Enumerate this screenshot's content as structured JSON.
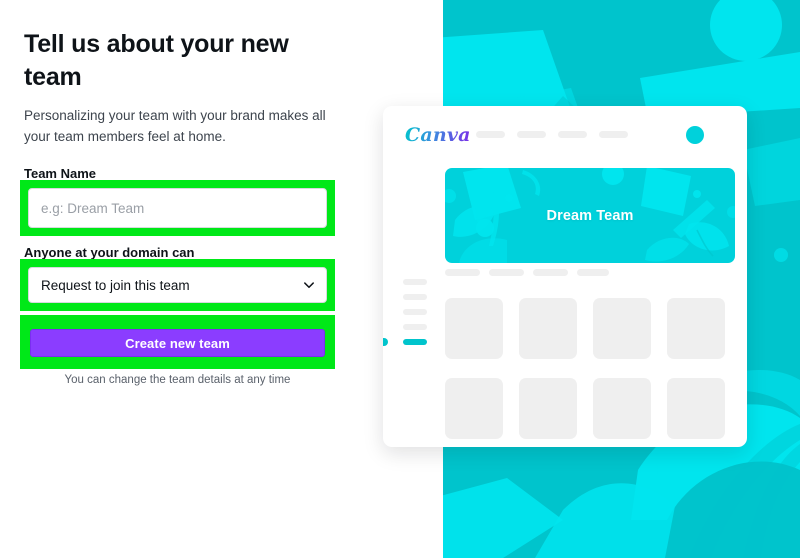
{
  "form": {
    "title": "Tell us about your new team",
    "subtitle": "Personalizing your team with your brand makes all your team members feel at home.",
    "team_name_label": "Team Name",
    "team_name_value": "",
    "team_name_placeholder": "e.g: Dream Team",
    "domain_label": "Anyone at your domain can",
    "domain_selected": "Request to join this team",
    "submit_label": "Create new team",
    "helper_text": "You can change the team details at any time"
  },
  "preview": {
    "logo_text": "Canva",
    "banner_title": "Dream Team",
    "nav_pills": [
      "",
      "",
      "",
      ""
    ],
    "sidebar_pills": [
      "",
      "",
      "",
      ""
    ],
    "tab_pills": [
      "",
      "",
      "",
      ""
    ],
    "thumbnails_row_a": [
      "",
      "",
      "",
      ""
    ],
    "thumbnails_row_b": [
      "",
      "",
      "",
      ""
    ]
  },
  "colors": {
    "brand_cyan": "#00C4CC",
    "banner_cyan": "#00D1DB",
    "accent_cyan_light": "#00E5EE",
    "purple_button": "#8B3DFF",
    "highlight_green": "#00E818",
    "placeholder_gray": "#9a9fa6",
    "text_dark": "#0e1318",
    "pill_gray": "#efefef"
  }
}
